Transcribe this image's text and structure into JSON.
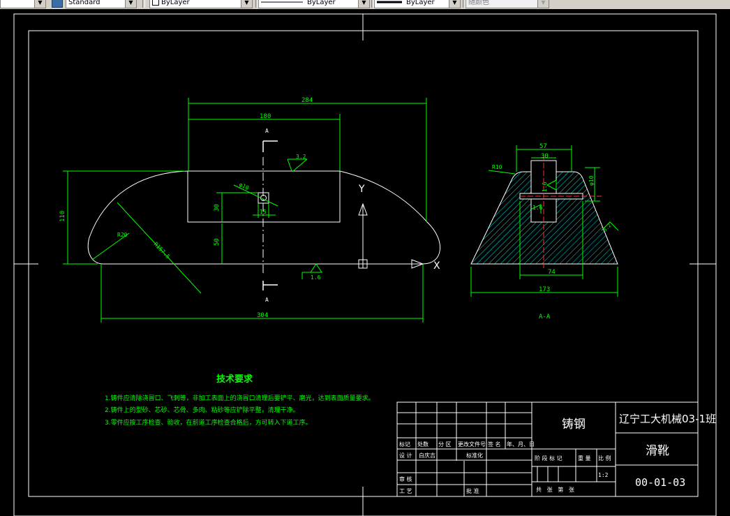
{
  "toolbar": {
    "text_style": "Standard",
    "layer": "ByLayer",
    "linetype": "ByLayer",
    "lineweight": "ByLayer",
    "color": "随颜色"
  },
  "drawing": {
    "front_view": {
      "dim_top": "284",
      "dim_inner": "180",
      "dim_bottom": "304",
      "dim_height": "110",
      "dim_30": "30",
      "dim_50": "50",
      "dim_15": "15",
      "radius_20": "R20",
      "radius_large": "R157.5",
      "hole": "φ10",
      "roughness_top": "3.2",
      "roughness_bottom": "1.6",
      "section_top": "A",
      "section_bottom": "A",
      "ucs_y": "Y",
      "ucs_x": "X"
    },
    "section_view": {
      "dim_57": "57",
      "dim_30": "30",
      "dim_74": "74",
      "dim_173": "173",
      "radius": "R10",
      "hole": "φ10",
      "rough_1": "1.6",
      "rough_2": "1.6",
      "rough_3": "3.2",
      "label": "A-A"
    },
    "tech_req": {
      "title": "技术要求",
      "items": [
        "1.铸件应清除浇冒口、飞刺等，非加工表面上的浇冒口清理后要铲平、磨光，达到表面质量要求。",
        "2.铸件上的型砂、芯砂、芯骨、多肉、粘砂等应铲除平整，清理干净。",
        "3.零件应按工序检查、验收，在前道工序检查合格后，方可转入下道工序。"
      ]
    },
    "title_block": {
      "material": "铸钢",
      "school": "辽宁工大机械03-1班",
      "part_name": "滑靴",
      "drawing_no": "00-01-03",
      "scale": "1:2",
      "row_headers": [
        "标记",
        "处数",
        "分 区",
        "更改文件号",
        "签 名",
        "年、月、日"
      ],
      "design_label": "设 计",
      "designer": "白庆吉",
      "standardize": "标准化",
      "review": "审 核",
      "process": "工 艺",
      "approve": "批 准",
      "stage_label": "阶 段 标 记",
      "weight_label": "重 量",
      "scale_label": "比 例",
      "sheets_label": "共   张   第   张"
    }
  }
}
